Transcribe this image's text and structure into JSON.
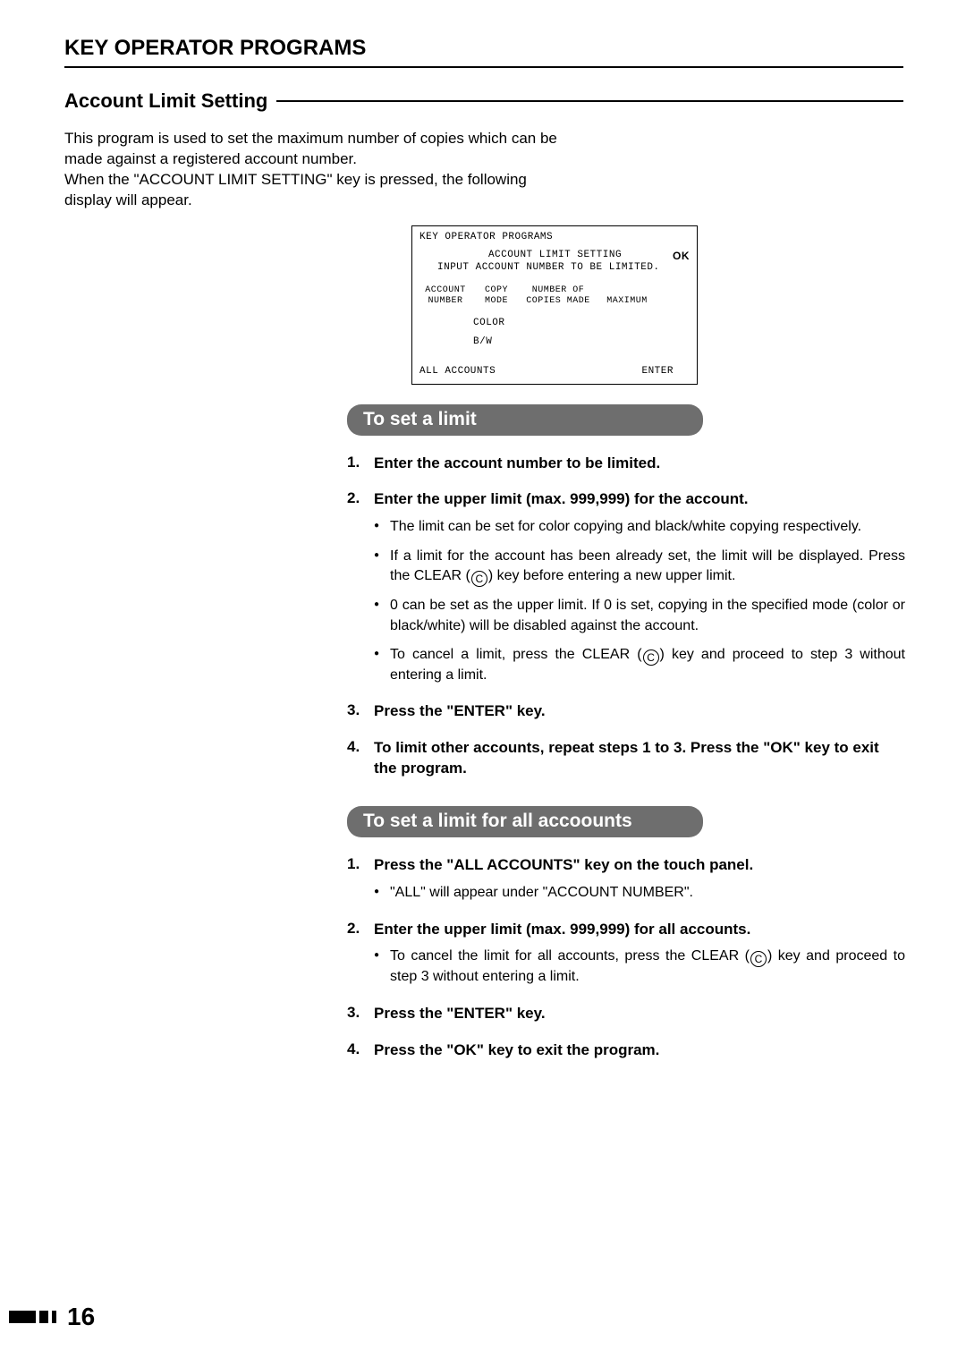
{
  "page": {
    "title": "KEY OPERATOR PROGRAMS",
    "section_heading": "Account Limit Setting",
    "intro": "This program is used to set the maximum number of copies which can be made against a registered account number.\nWhen the \"ACCOUNT LIMIT SETTING\" key is pressed, the following display will appear.",
    "page_number": "16"
  },
  "screen": {
    "top_label": "KEY OPERATOR PROGRAMS",
    "title": "ACCOUNT LIMIT SETTING",
    "ok": "OK",
    "prompt": "INPUT ACCOUNT NUMBER TO BE LIMITED.",
    "columns": {
      "c1a": "ACCOUNT",
      "c1b": "NUMBER",
      "c2a": "COPY",
      "c2b": "MODE",
      "c3a": "NUMBER OF",
      "c3b": "COPIES MADE",
      "c4": "MAXIMUM"
    },
    "mode_color": "COLOR",
    "mode_bw": "B/W",
    "footer_left": "ALL ACCOUNTS",
    "footer_right": "ENTER"
  },
  "block1": {
    "header": "To set a limit",
    "steps": [
      {
        "title": "Enter the account number to be limited.",
        "bullets": []
      },
      {
        "title": "Enter the upper limit (max. 999,999) for the account.",
        "bullets": [
          {
            "text_before": "The limit can be set for color copying and black/white copying respectively."
          },
          {
            "text_before": "If a limit for the account has been already set, the limit will be displayed. Press the CLEAR (",
            "icon": "C",
            "text_after": ") key before entering a new upper limit."
          },
          {
            "text_before": "0 can be set as the upper limit. If 0 is set, copying in the specified mode (color or black/white) will be disabled against the account."
          },
          {
            "text_before": "To cancel a limit, press the CLEAR (",
            "icon": "C",
            "text_after": ") key and proceed to step 3 without entering a limit."
          }
        ]
      },
      {
        "title": "Press the \"ENTER\" key.",
        "bullets": []
      },
      {
        "title": "To limit other accounts, repeat steps 1 to 3. Press the \"OK\" key to exit the program.",
        "bullets": []
      }
    ]
  },
  "block2": {
    "header": "To set a limit for all accoounts",
    "steps": [
      {
        "title": "Press the \"ALL ACCOUNTS\" key on the touch panel.",
        "bullets": [
          {
            "text_before": "\"ALL\" will appear under \"ACCOUNT NUMBER\"."
          }
        ]
      },
      {
        "title": "Enter the upper limit (max. 999,999) for all accounts.",
        "bullets": [
          {
            "text_before": "To cancel the limit for all accounts, press the CLEAR (",
            "icon": "C",
            "text_after": ") key and proceed to step 3 without entering a limit."
          }
        ]
      },
      {
        "title": "Press the \"ENTER\" key.",
        "bullets": []
      },
      {
        "title": "Press the \"OK\" key to exit the program.",
        "bullets": []
      }
    ]
  }
}
